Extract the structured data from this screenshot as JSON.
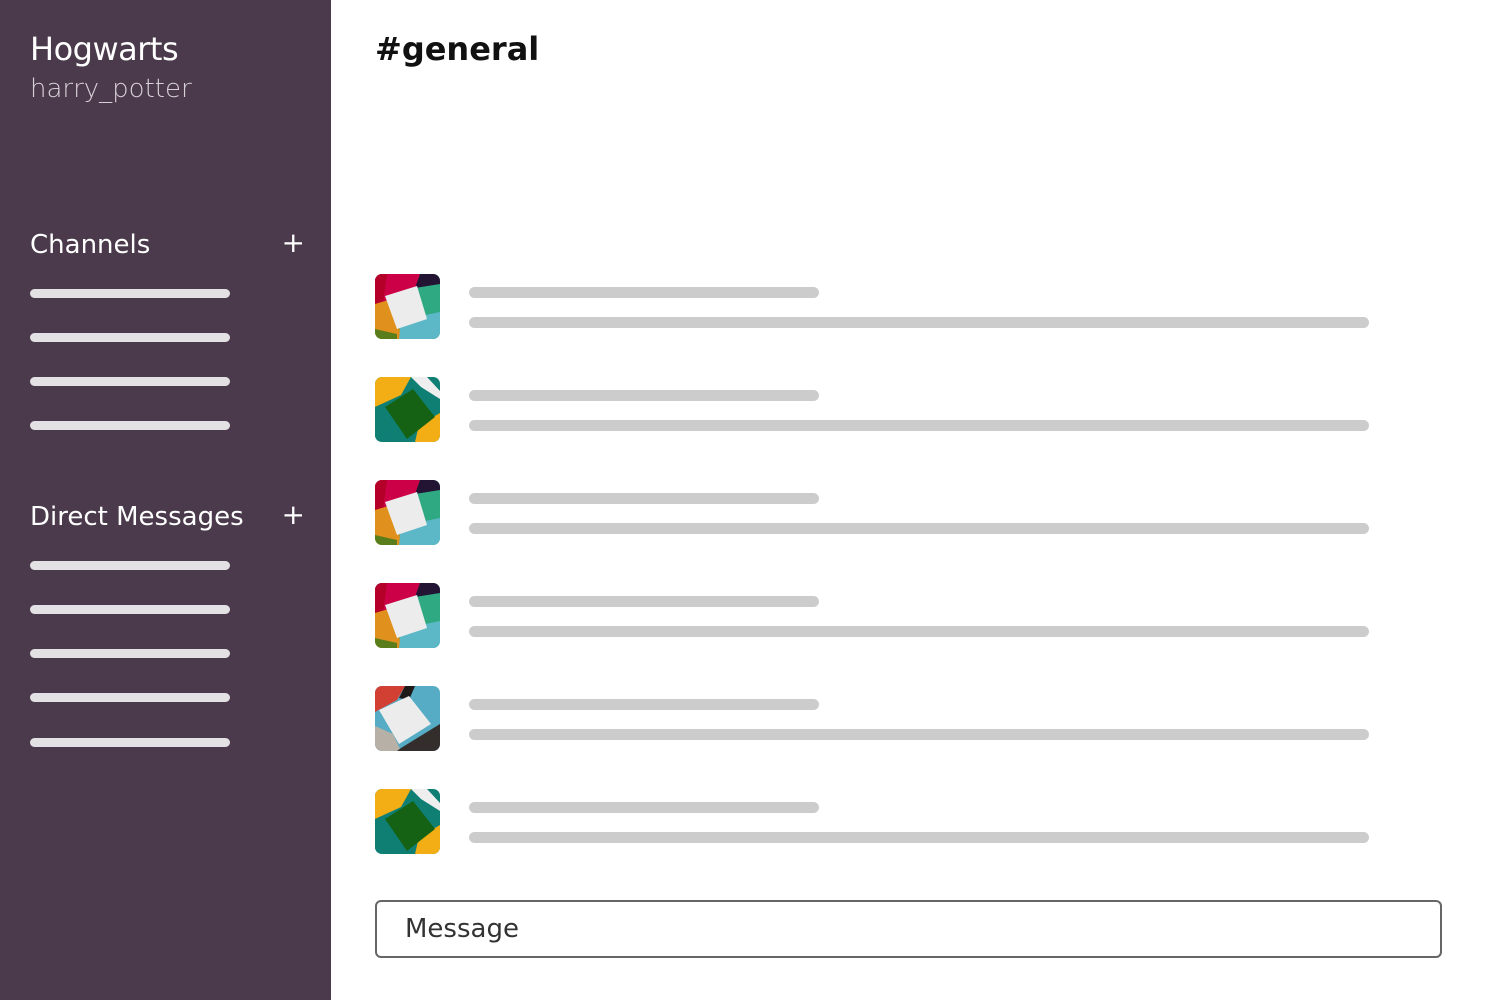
{
  "sidebar": {
    "team_name": "Hogwarts",
    "user_name": "harry_potter",
    "background": "#4a3a4b",
    "channels": {
      "label": "Channels",
      "add_label": "+",
      "items": [
        "",
        "",
        "",
        ""
      ]
    },
    "direct_messages": {
      "label": "Direct Messages",
      "add_label": "+",
      "items": [
        "",
        "",
        "",
        "",
        ""
      ]
    }
  },
  "main": {
    "channel_title": "#general",
    "messages": [
      {
        "avatar": "avatar-pattern-red-green"
      },
      {
        "avatar": "avatar-pattern-yellow-green"
      },
      {
        "avatar": "avatar-pattern-red-green"
      },
      {
        "avatar": "avatar-pattern-red-green"
      },
      {
        "avatar": "avatar-pattern-red-blue"
      },
      {
        "avatar": "avatar-pattern-yellow-green"
      }
    ],
    "composer": {
      "placeholder": "Message"
    }
  }
}
